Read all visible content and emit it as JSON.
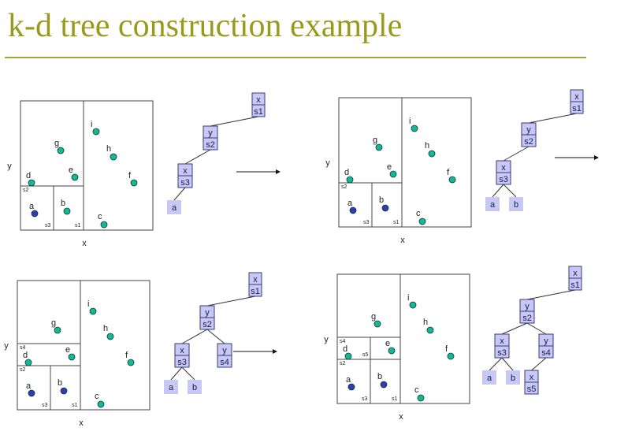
{
  "title": "k-d tree construction example",
  "colors": {
    "title": "#999a1c",
    "point_teal": "#13b996",
    "point_blue": "#2f3cb5",
    "node_fill": "#c8c8f4",
    "node_stroke": "#3a3a80"
  },
  "axes": {
    "x": "x",
    "y": "y"
  },
  "panels": [
    {
      "points": [
        {
          "id": "a",
          "label": "a",
          "color": "blue"
        },
        {
          "id": "b",
          "label": "b",
          "color": "teal"
        },
        {
          "id": "c",
          "label": "c",
          "color": "teal"
        },
        {
          "id": "d",
          "label": "d",
          "color": "teal"
        },
        {
          "id": "e",
          "label": "e",
          "color": "teal"
        },
        {
          "id": "f",
          "label": "f",
          "color": "teal"
        },
        {
          "id": "g",
          "label": "g",
          "color": "teal"
        },
        {
          "id": "h",
          "label": "h",
          "color": "teal"
        },
        {
          "id": "i",
          "label": "i",
          "color": "teal"
        }
      ],
      "splits": [
        "s1",
        "s2",
        "s3"
      ],
      "tree": [
        {
          "id": "n1",
          "top": "x",
          "bottom": "s1"
        },
        {
          "id": "n2",
          "top": "y",
          "bottom": "s2"
        },
        {
          "id": "n3",
          "top": "x",
          "bottom": "s3"
        },
        {
          "id": "la",
          "leaf": "a"
        }
      ],
      "arrow": true
    },
    {
      "points": [
        {
          "id": "a",
          "label": "a",
          "color": "blue"
        },
        {
          "id": "b",
          "label": "b",
          "color": "blue"
        },
        {
          "id": "c",
          "label": "c",
          "color": "teal"
        },
        {
          "id": "d",
          "label": "d",
          "color": "teal"
        },
        {
          "id": "e",
          "label": "e",
          "color": "teal"
        },
        {
          "id": "f",
          "label": "f",
          "color": "teal"
        },
        {
          "id": "g",
          "label": "g",
          "color": "teal"
        },
        {
          "id": "h",
          "label": "h",
          "color": "teal"
        },
        {
          "id": "i",
          "label": "i",
          "color": "teal"
        }
      ],
      "splits": [
        "s1",
        "s2",
        "s3"
      ],
      "tree": [
        {
          "id": "n1",
          "top": "x",
          "bottom": "s1"
        },
        {
          "id": "n2",
          "top": "y",
          "bottom": "s2"
        },
        {
          "id": "n3",
          "top": "x",
          "bottom": "s3"
        },
        {
          "id": "la",
          "leaf": "a"
        },
        {
          "id": "lb",
          "leaf": "b"
        }
      ],
      "arrow": true
    },
    {
      "points": [
        {
          "id": "a",
          "label": "a",
          "color": "blue"
        },
        {
          "id": "b",
          "label": "b",
          "color": "blue"
        },
        {
          "id": "c",
          "label": "c",
          "color": "teal"
        },
        {
          "id": "d",
          "label": "d",
          "color": "teal"
        },
        {
          "id": "e",
          "label": "e",
          "color": "teal"
        },
        {
          "id": "f",
          "label": "f",
          "color": "teal"
        },
        {
          "id": "g",
          "label": "g",
          "color": "teal"
        },
        {
          "id": "h",
          "label": "h",
          "color": "teal"
        },
        {
          "id": "i",
          "label": "i",
          "color": "teal"
        }
      ],
      "splits": [
        "s1",
        "s2",
        "s3",
        "s4"
      ],
      "tree": [
        {
          "id": "n1",
          "top": "x",
          "bottom": "s1"
        },
        {
          "id": "n2",
          "top": "y",
          "bottom": "s2"
        },
        {
          "id": "n3",
          "top": "x",
          "bottom": "s3"
        },
        {
          "id": "n4",
          "top": "y",
          "bottom": "s4"
        },
        {
          "id": "la",
          "leaf": "a"
        },
        {
          "id": "lb",
          "leaf": "b"
        }
      ],
      "arrow": true
    },
    {
      "points": [
        {
          "id": "a",
          "label": "a",
          "color": "blue"
        },
        {
          "id": "b",
          "label": "b",
          "color": "blue"
        },
        {
          "id": "c",
          "label": "c",
          "color": "teal"
        },
        {
          "id": "d",
          "label": "d",
          "color": "teal"
        },
        {
          "id": "e",
          "label": "e",
          "color": "teal"
        },
        {
          "id": "f",
          "label": "f",
          "color": "teal"
        },
        {
          "id": "g",
          "label": "g",
          "color": "teal"
        },
        {
          "id": "h",
          "label": "h",
          "color": "teal"
        },
        {
          "id": "i",
          "label": "i",
          "color": "teal"
        }
      ],
      "splits": [
        "s1",
        "s2",
        "s3",
        "s4",
        "s5"
      ],
      "tree": [
        {
          "id": "n1",
          "top": "x",
          "bottom": "s1"
        },
        {
          "id": "n2",
          "top": "y",
          "bottom": "s2"
        },
        {
          "id": "n3",
          "top": "x",
          "bottom": "s3"
        },
        {
          "id": "n4",
          "top": "y",
          "bottom": "s4"
        },
        {
          "id": "n5",
          "top": "x",
          "bottom": "s5"
        },
        {
          "id": "la",
          "leaf": "a"
        },
        {
          "id": "lb",
          "leaf": "b"
        }
      ],
      "arrow": false
    }
  ]
}
